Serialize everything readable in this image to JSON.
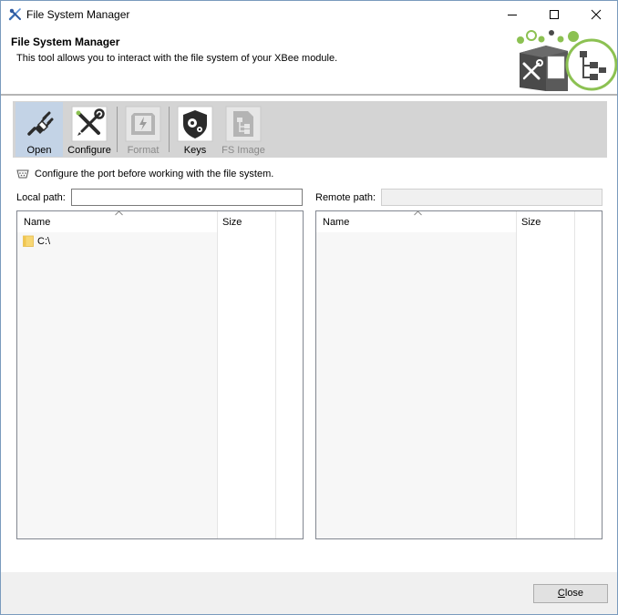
{
  "window": {
    "title": "File System Manager"
  },
  "header": {
    "title": "File System Manager",
    "description": "This tool allows you to interact with the file system of your XBee module."
  },
  "toolbar": {
    "items": [
      {
        "label": "Open",
        "icon": "plug-icon",
        "enabled": true,
        "selected": true
      },
      {
        "label": "Configure",
        "icon": "tools-icon",
        "enabled": true,
        "selected": false
      },
      {
        "label": "Format",
        "icon": "format-icon",
        "enabled": false,
        "selected": false
      },
      {
        "label": "Keys",
        "icon": "shield-key-icon",
        "enabled": true,
        "selected": false
      },
      {
        "label": "FS Image",
        "icon": "fs-image-icon",
        "enabled": false,
        "selected": false
      }
    ]
  },
  "info": {
    "text": "Configure the port before working with the file system.",
    "icon": "serial-port-icon"
  },
  "local": {
    "label": "Local path:",
    "value": "",
    "columns": [
      "Name",
      "Size"
    ],
    "rows": [
      {
        "name": "C:\\",
        "size": "",
        "icon": "folder-icon"
      }
    ]
  },
  "remote": {
    "label": "Remote path:",
    "value": "",
    "columns": [
      "Name",
      "Size"
    ],
    "rows": []
  },
  "footer": {
    "close_label": "Close",
    "close_mnemonic": "C"
  },
  "colors": {
    "accent_green": "#8cc152",
    "logo_dark": "#4a4a4a",
    "selected_tool": "#c3d3e6",
    "toolbar_bg": "#d4d4d4"
  }
}
